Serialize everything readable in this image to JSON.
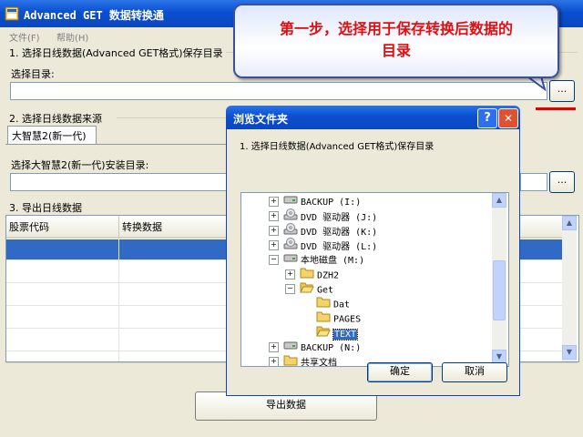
{
  "app": {
    "title": "Advanced GET 数据转换通"
  },
  "menu": [
    {
      "label": "文件(F)"
    },
    {
      "label": "帮助(H)"
    }
  ],
  "section1": {
    "title": "1. 选择日线数据(Advanced GET格式)保存目录",
    "dir_label": "选择目录:",
    "dir_value": "",
    "browse_label": "..."
  },
  "section2": {
    "title": "2. 选择日线数据来源",
    "tab_label": "大智慧2(新一代)",
    "dir_label": "选择大智慧2(新一代)安装目录:",
    "dir_value": "",
    "browse_label": "..."
  },
  "section3": {
    "title": "3. 导出日线数据",
    "columns": [
      "股票代码",
      "转换数据"
    ],
    "rows": [
      [
        "",
        ""
      ],
      [
        "",
        ""
      ],
      [
        "",
        ""
      ],
      [
        "",
        ""
      ],
      [
        "",
        ""
      ],
      [
        "",
        ""
      ],
      [
        "",
        ""
      ]
    ],
    "selected_row": 0,
    "export_button": "导出数据"
  },
  "callout": {
    "text_line1": "第一步，选择用于保存转换后数据的",
    "text_line2": "目录"
  },
  "dialog": {
    "title": "浏览文件夹",
    "help_label": "?",
    "close_label": "✕",
    "prompt": "1. 选择日线数据(Advanced GET格式)保存目录",
    "tree": [
      {
        "label": "BACKUP (I:)",
        "icon": "drive-icon",
        "expander": "+",
        "level": 0
      },
      {
        "label": "DVD 驱动器 (J:)",
        "icon": "cd-drive-icon",
        "expander": "+",
        "level": 0
      },
      {
        "label": "DVD 驱动器 (K:)",
        "icon": "cd-drive-icon",
        "expander": "+",
        "level": 0
      },
      {
        "label": "DVD 驱动器 (L:)",
        "icon": "cd-drive-icon",
        "expander": "+",
        "level": 0
      },
      {
        "label": "本地磁盘 (M:)",
        "icon": "drive-icon",
        "expander": "−",
        "level": 0
      },
      {
        "label": "DZH2",
        "icon": "folder-icon",
        "expander": "+",
        "level": 1
      },
      {
        "label": "Get",
        "icon": "folder-open-icon",
        "expander": "−",
        "level": 1
      },
      {
        "label": "Dat",
        "icon": "folder-icon",
        "expander": "",
        "level": 2
      },
      {
        "label": "PAGES",
        "icon": "folder-icon",
        "expander": "",
        "level": 2
      },
      {
        "label": "TEXT",
        "icon": "folder-open-icon",
        "expander": "",
        "level": 2,
        "selected": true
      },
      {
        "label": "BACKUP (N:)",
        "icon": "drive-icon",
        "expander": "+",
        "level": 0
      },
      {
        "label": "共享文档",
        "icon": "folder-icon",
        "expander": "+",
        "level": 0
      }
    ],
    "ok_label": "确定",
    "cancel_label": "取消"
  },
  "colors": {
    "titlebar": "#0b46c0",
    "selection": "#316ac5",
    "callout_text": "#e01010",
    "close_button": "#e0522f",
    "underline": "#e00000"
  }
}
